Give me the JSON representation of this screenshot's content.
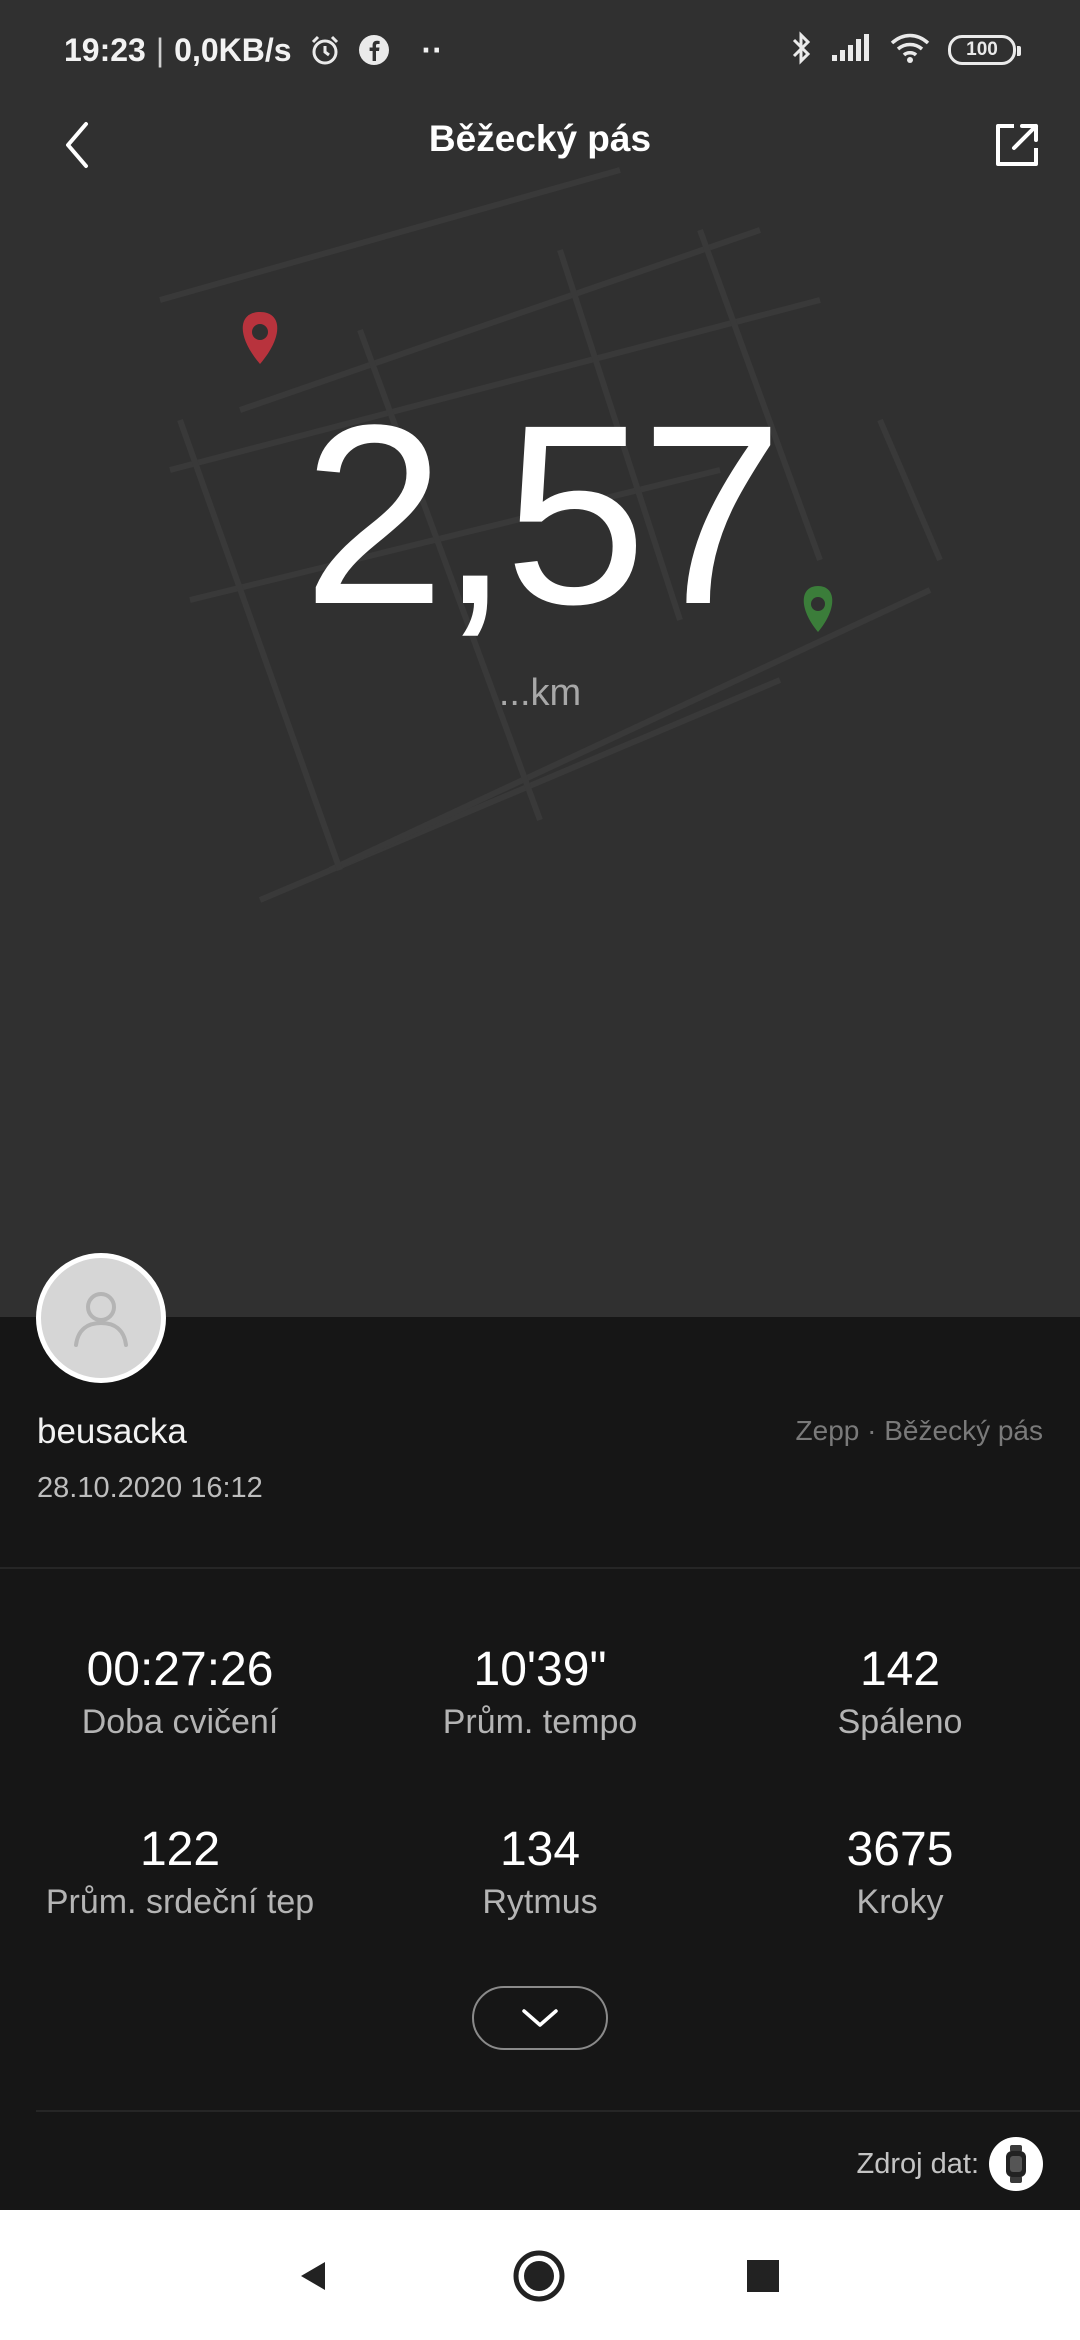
{
  "status_bar": {
    "time": "19:23",
    "separator": "|",
    "speed": "0,0KB/s",
    "more": "··",
    "battery": "100",
    "icons": [
      "alarm-icon",
      "facebook-icon",
      "bluetooth-icon",
      "signal-icon",
      "wifi-icon",
      "battery-icon"
    ]
  },
  "header": {
    "title": "Běžecký pás",
    "back_icon": "chevron-left-icon",
    "share_icon": "share-icon"
  },
  "workout": {
    "distance": "2,57",
    "unit": "...km"
  },
  "user": {
    "name": "beusacka",
    "date": "28.10.2020 16:12",
    "source": "Zepp · Běžecký pás"
  },
  "stats": [
    {
      "value": "00:27:26",
      "label": "Doba cvičení"
    },
    {
      "value": "10'39\"",
      "label": "Prům. tempo"
    },
    {
      "value": "142",
      "label": "Spáleno"
    },
    {
      "value": "122",
      "label": "Prům. srdeční tep"
    },
    {
      "value": "134",
      "label": "Rytmus"
    },
    {
      "value": "3675",
      "label": "Kroky"
    }
  ],
  "footer": {
    "data_source_label": "Zdroj dat:",
    "device_icon": "watch-icon"
  },
  "colors": {
    "top_background": "#303030",
    "bottom_background": "#161616",
    "start_pin": "#b8333d",
    "end_pin": "#3b7d3a"
  }
}
